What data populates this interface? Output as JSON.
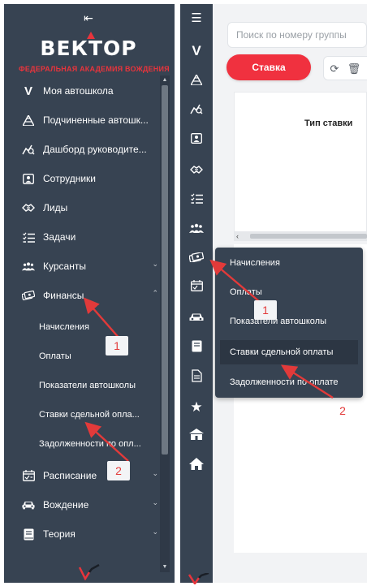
{
  "left": {
    "logo_text": "ВЕКТОР",
    "logo_subtitle": "ФЕДЕРАЛЬНАЯ АКАДЕМИЯ ВОЖДЕНИЯ",
    "nav": [
      {
        "label": "Моя автошкола",
        "icon": "v-logo-icon"
      },
      {
        "label": "Подчиненные автошк...",
        "icon": "pyramid-icon"
      },
      {
        "label": "Дашборд руководите...",
        "icon": "chart-search-icon"
      },
      {
        "label": "Сотрудники",
        "icon": "id-card-icon"
      },
      {
        "label": "Лиды",
        "icon": "handshake-icon"
      },
      {
        "label": "Задачи",
        "icon": "checklist-icon"
      },
      {
        "label": "Курсанты",
        "icon": "group-icon"
      },
      {
        "label": "Финансы",
        "icon": "money-icon"
      },
      {
        "label": "Расписание",
        "icon": "calendar-icon"
      },
      {
        "label": "Вождение",
        "icon": "car-icon"
      },
      {
        "label": "Теория",
        "icon": "book-icon"
      }
    ],
    "finance_sub": [
      "Начисления",
      "Оплаты",
      "Показатели автошколы",
      "Ставки сдельной опла...",
      "Задолженности по опл..."
    ]
  },
  "right": {
    "search_placeholder": "Поиск по номеру группы",
    "rate_button": "Ставка",
    "table_header": "Тип ставки",
    "flyout": [
      "Начисления",
      "Оплаты",
      "Показатели автошколы",
      "Ставки сдельной оплаты",
      "Задолженности по оплате"
    ]
  },
  "annotations": {
    "left_badge_1": "1",
    "left_badge_2": "2",
    "right_badge_1": "1",
    "right_badge_2": "2"
  },
  "colors": {
    "sidebar": "#374352",
    "accent_red": "#f0313f",
    "annotation_red": "#e23a3a"
  }
}
